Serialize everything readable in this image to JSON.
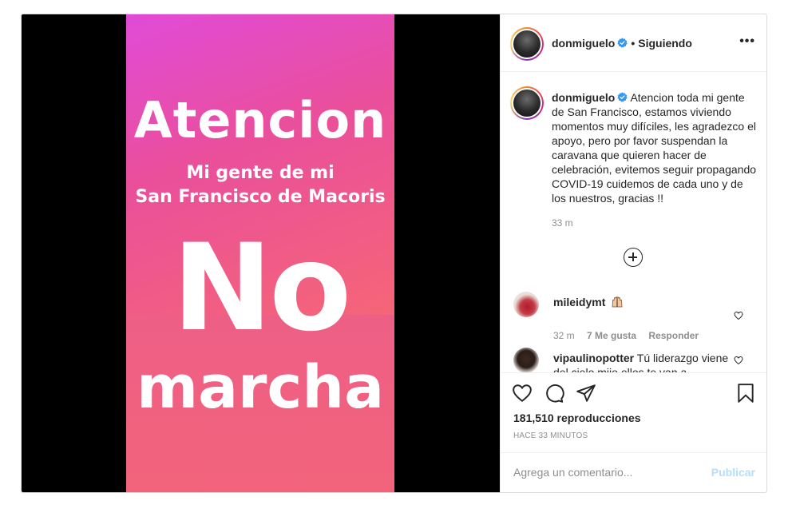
{
  "video": {
    "title": "Atencion",
    "subtitle_line1": "Mi gente de mi",
    "subtitle_line2": "San Francisco de Macoris",
    "big_word": "No",
    "big_word2": "marcha"
  },
  "header": {
    "username": "donmiguelo",
    "separator": "•",
    "follow_status": "Siguiendo",
    "more_label": "•••"
  },
  "caption": {
    "username": "donmiguelo",
    "text": "Atencion toda mi gente de San Francisco, estamos viviendo momentos muy difíciles, les agradezco el apoyo, pero por favor suspendan la caravana que quieren hacer de celebración, evitemos seguir propagando COVID-19 cuidemos de cada uno y de los nuestros, gracias !!",
    "time": "33 m"
  },
  "comments": [
    {
      "username": "mileidymt",
      "text": "",
      "emoji": "raising-hands-emoji",
      "time": "32 m",
      "likes": "7 Me gusta",
      "reply": "Responder"
    },
    {
      "username": "vipaulinopotter",
      "text": "Tú liderazgo viene del cielo mijo ellos te van a"
    }
  ],
  "stats": {
    "views": "181,510 reproducciones",
    "time_ago": "HACE 33 MINUTOS"
  },
  "add_comment": {
    "placeholder": "Agrega un comentario...",
    "publish": "Publicar"
  },
  "colors": {
    "verified": "#3897f0",
    "publish_disabled": "#b2dffc",
    "text": "#262626",
    "muted": "#8e8e8e"
  }
}
